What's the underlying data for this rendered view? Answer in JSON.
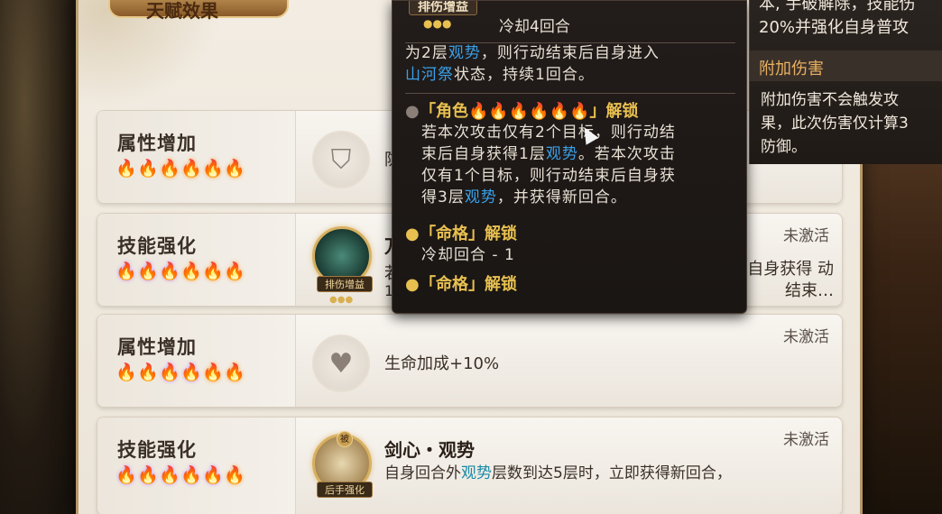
{
  "banner": {
    "title": "天赋效果"
  },
  "cards": [
    {
      "category": "属性增加",
      "flames": [
        "g",
        "g",
        "o",
        "o",
        "o",
        "o"
      ],
      "status": "",
      "icon": "shield-percent-icon",
      "desc": "防"
    },
    {
      "category": "技能强化",
      "flames": [
        "p",
        "p",
        "p",
        "o",
        "o",
        "o"
      ],
      "status": "未激活",
      "icon_tag": "排伤增益",
      "skill_name": "万",
      "skill_desc_left": "若",
      "skill_desc_left2": "1",
      "skill_desc_right": "自身获得 动结束…"
    },
    {
      "category": "属性增加",
      "flames": [
        "g",
        "g",
        "p",
        "p",
        "o",
        "o"
      ],
      "status": "未激活",
      "icon": "heart-percent-icon",
      "desc": "生命加成+10%"
    },
    {
      "category": "技能强化",
      "flames": [
        "p",
        "p",
        "p",
        "p",
        "p",
        "o"
      ],
      "status": "未激活",
      "icon_tag": "后手强化",
      "icon_badge": "被",
      "skill_name": "剑心・观势",
      "skill_desc_a": "自身回合外",
      "skill_desc_hl": "观势",
      "skill_desc_b": "层数到达5层时，立即获得新回合，"
    }
  ],
  "tooltip": {
    "icon_label": "排伤增益",
    "cooldown": "冷却4回合",
    "line1a": "为2层",
    "line1hl": "观势",
    "line1b": "，则行动结束后自身进入",
    "line2hl": "山河祭",
    "line2b": "状态，持续1回合。",
    "sec1_head_a": "「角色",
    "sec1_head_b": "」解锁",
    "sec1_flames": [
      "p",
      "p",
      "p",
      "o",
      "o",
      "o"
    ],
    "sec1_body1": "若本次攻击仅有2个目标，则行动结",
    "sec1_body2a": "束后自身获得1层",
    "sec1_body2hl": "观势",
    "sec1_body2b": "。若本次攻击",
    "sec1_body3": "仅有1个目标，则行动结束后自身获",
    "sec1_body4a": "得3层",
    "sec1_body4hl": "观势",
    "sec1_body4b": "，并获得新回合。",
    "sec2_head": "「命格」解锁",
    "sec2_body": "冷却回合 - 1",
    "sec3_head": "「命格」解锁"
  },
  "right_tip": {
    "top_line1": "本, 手破解除，技能伤",
    "top_line2": "20%并强化自身普攻",
    "head": "附加伤害",
    "body1": "附加伤害不会触发攻",
    "body2": "果，此次伤害仅计算3",
    "body3": "防御。"
  }
}
